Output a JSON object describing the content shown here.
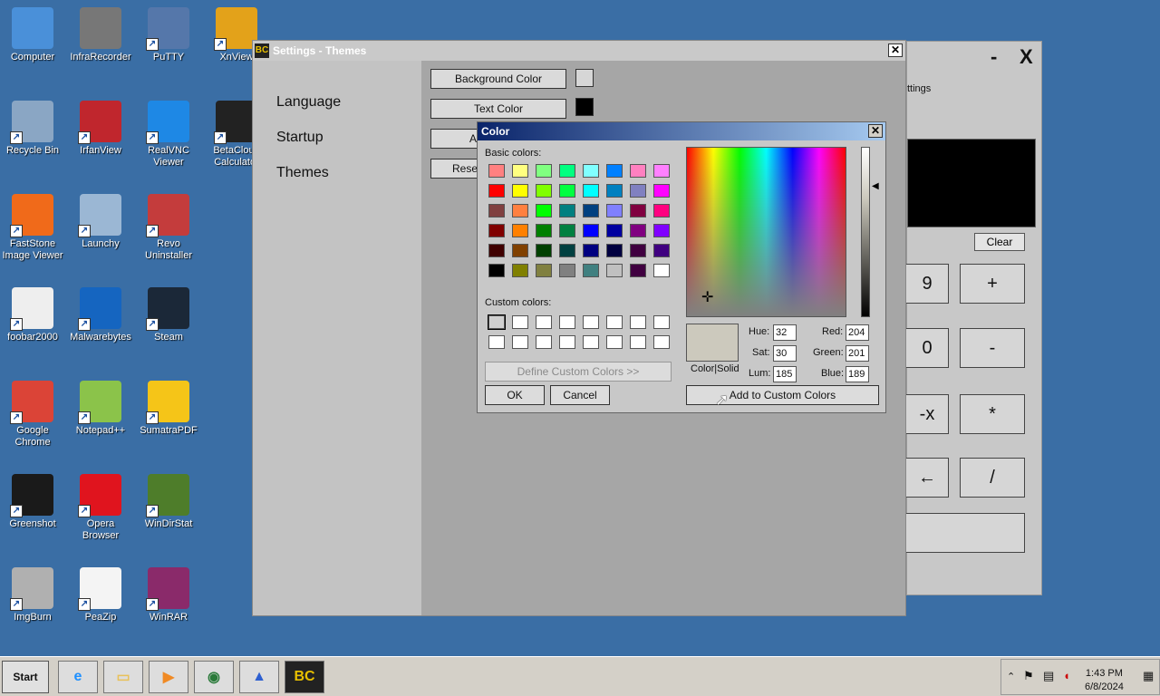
{
  "desktop": {
    "icons": [
      {
        "label": "Computer",
        "icon": "computer-icon",
        "color": "#4a90d9"
      },
      {
        "label": "InfraRecorder",
        "icon": "infrarecorder-icon",
        "color": "#777777"
      },
      {
        "label": "PuTTY",
        "icon": "putty-icon",
        "color": "#5577aa"
      },
      {
        "label": "XnView",
        "icon": "xnview-icon",
        "color": "#e3a21a"
      },
      {
        "label": "Recycle Bin",
        "icon": "recycle-bin-icon",
        "color": "#8aa6c4"
      },
      {
        "label": "IrfanView",
        "icon": "irfanview-icon",
        "color": "#c0262d"
      },
      {
        "label": "RealVNC Viewer",
        "icon": "realvnc-icon",
        "color": "#1e88e5"
      },
      {
        "label": "BetaCloud Calculator",
        "icon": "betacloud-calculator-icon",
        "color": "#222222"
      },
      {
        "label": "FastStone Image Viewer",
        "icon": "faststone-icon",
        "color": "#f06a1a"
      },
      {
        "label": "Launchy",
        "icon": "launchy-icon",
        "color": "#9bb7d4"
      },
      {
        "label": "Revo Uninstaller",
        "icon": "revo-uninstaller-icon",
        "color": "#c43c3c"
      },
      {
        "label": "foobar2000",
        "icon": "foobar2000-icon",
        "color": "#eeeeee"
      },
      {
        "label": "Malwarebytes",
        "icon": "malwarebytes-icon",
        "color": "#1565c0"
      },
      {
        "label": "Steam",
        "icon": "steam-icon",
        "color": "#1b2838"
      },
      {
        "label": "Google Chrome",
        "icon": "chrome-icon",
        "color": "#db4437"
      },
      {
        "label": "Notepad++",
        "icon": "notepadpp-icon",
        "color": "#8bc34a"
      },
      {
        "label": "SumatraPDF",
        "icon": "sumatrapdf-icon",
        "color": "#f5c518"
      },
      {
        "label": "Greenshot",
        "icon": "greenshot-icon",
        "color": "#1a1a1a"
      },
      {
        "label": "Opera Browser",
        "icon": "opera-icon",
        "color": "#e0141e"
      },
      {
        "label": "WinDirStat",
        "icon": "windirstat-icon",
        "color": "#4e7d2a"
      },
      {
        "label": "ImgBurn",
        "icon": "imgburn-icon",
        "color": "#b0b0b0"
      },
      {
        "label": "PeaZip",
        "icon": "peazip-icon",
        "color": "#f4f4f4"
      },
      {
        "label": "WinRAR",
        "icon": "winrar-icon",
        "color": "#8a2a6a"
      }
    ]
  },
  "calculator": {
    "minimize": "-",
    "close": "X",
    "menu_fragment": "ttings",
    "clear_label": "Clear",
    "buttons": [
      "9",
      "+",
      "0",
      "-",
      "-x",
      "*",
      "←",
      "/",
      ""
    ]
  },
  "settings": {
    "title": "Settings - Themes",
    "close": "✕",
    "nav": [
      "Language",
      "Startup",
      "Themes"
    ],
    "buttons": [
      {
        "label": "Background Color",
        "swatch": "#d6d6d6"
      },
      {
        "label": "Text Color",
        "swatch": "#000000"
      },
      {
        "label": "A",
        "swatch": ""
      },
      {
        "label": "Reset",
        "swatch": ""
      }
    ]
  },
  "color_dialog": {
    "title": "Color",
    "close": "✕",
    "basic_colors_label": "Basic colors:",
    "basic_colors": [
      "#ff8080",
      "#ffff80",
      "#80ff80",
      "#00ff80",
      "#80ffff",
      "#0080ff",
      "#ff80c0",
      "#ff80ff",
      "#ff0000",
      "#ffff00",
      "#80ff00",
      "#00ff40",
      "#00ffff",
      "#0080c0",
      "#8080c0",
      "#ff00ff",
      "#804040",
      "#ff8040",
      "#00ff00",
      "#008080",
      "#004080",
      "#8080ff",
      "#800040",
      "#ff0080",
      "#800000",
      "#ff8000",
      "#008000",
      "#008040",
      "#0000ff",
      "#0000a0",
      "#800080",
      "#8000ff",
      "#400000",
      "#804000",
      "#004000",
      "#004040",
      "#000080",
      "#000040",
      "#400040",
      "#400080",
      "#000000",
      "#808000",
      "#808040",
      "#808080",
      "#408080",
      "#c0c0c0",
      "#400040",
      "#ffffff"
    ],
    "custom_colors_label": "Custom colors:",
    "define_custom_label": "Define Custom Colors >>",
    "ok_label": "OK",
    "cancel_label": "Cancel",
    "color_solid_label": "Color|Solid",
    "preview_color": "#ccc9bd",
    "hue_label": "Hue:",
    "hue": "32",
    "sat_label": "Sat:",
    "sat": "30",
    "lum_label": "Lum:",
    "lum": "185",
    "red_label": "Red:",
    "red": "204",
    "green_label": "Green:",
    "green": "201",
    "blue_label": "Blue:",
    "blue": "189",
    "add_custom_label": "Add to Custom Colors"
  },
  "taskbar": {
    "start_label": "Start",
    "apps": [
      {
        "icon": "internet-explorer-icon",
        "glyph": "e",
        "color": "#1e90ff"
      },
      {
        "icon": "file-explorer-icon",
        "glyph": "▭",
        "color": "#e8c15a"
      },
      {
        "icon": "media-player-icon",
        "glyph": "▶",
        "color": "#f08a24"
      },
      {
        "icon": "network-globe-icon",
        "glyph": "◉",
        "color": "#2a7a3a"
      },
      {
        "icon": "app-launcher-icon",
        "glyph": "▲",
        "color": "#2d5fd0"
      },
      {
        "icon": "betacloud-calculator-icon",
        "glyph": "BC",
        "color": "#e8c000"
      }
    ],
    "time": "1:43 PM",
    "date": "6/8/2024"
  }
}
